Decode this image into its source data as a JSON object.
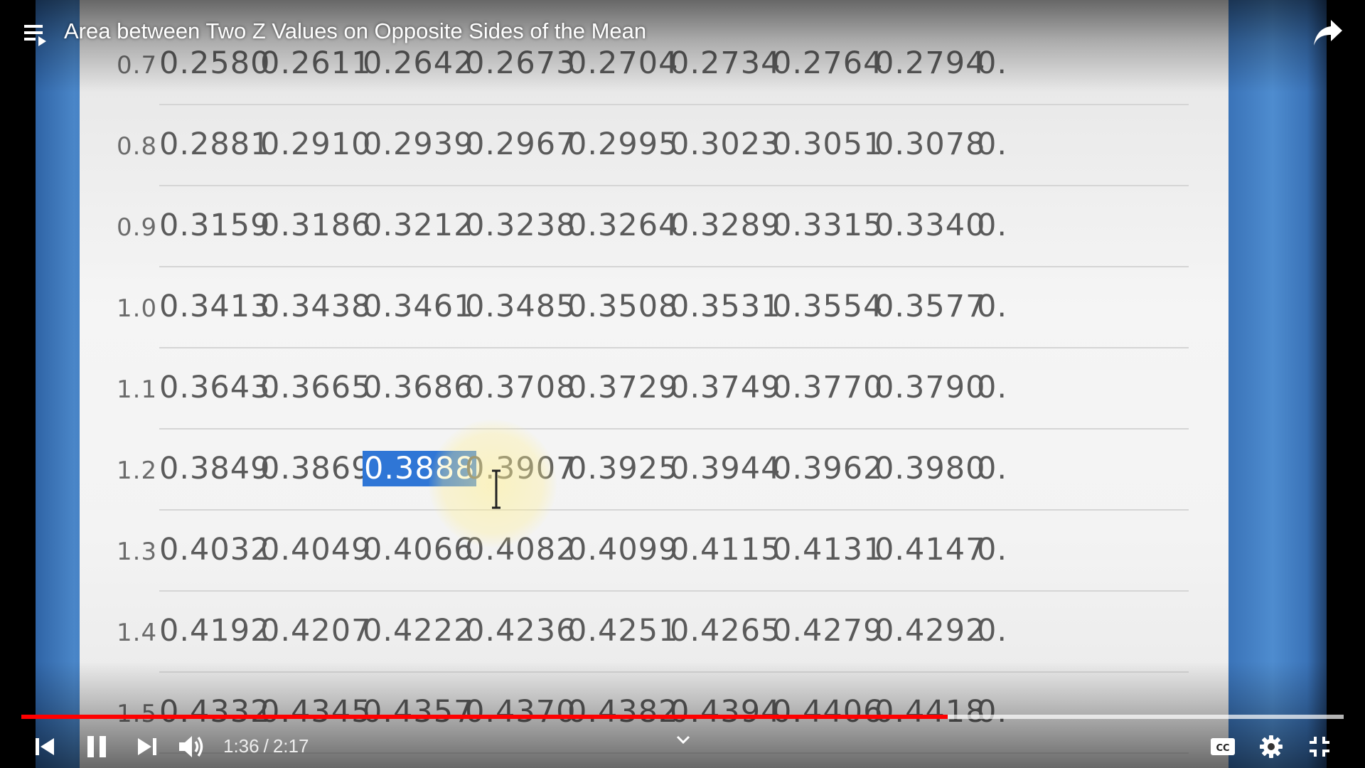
{
  "title_bar": {
    "title": "Area between Two Z Values on Opposite Sides of the Mean"
  },
  "table": {
    "rows": [
      {
        "z": "0.7",
        "values": [
          "0.2580",
          "0.2611",
          "0.2642",
          "0.2673",
          "0.2704",
          "0.2734",
          "0.2764",
          "0.2794",
          "0."
        ]
      },
      {
        "z": "0.8",
        "values": [
          "0.2881",
          "0.2910",
          "0.2939",
          "0.2967",
          "0.2995",
          "0.3023",
          "0.3051",
          "0.3078",
          "0."
        ]
      },
      {
        "z": "0.9",
        "values": [
          "0.3159",
          "0.3186",
          "0.3212",
          "0.3238",
          "0.3264",
          "0.3289",
          "0.3315",
          "0.3340",
          "0."
        ]
      },
      {
        "z": "1.0",
        "values": [
          "0.3413",
          "0.3438",
          "0.3461",
          "0.3485",
          "0.3508",
          "0.3531",
          "0.3554",
          "0.3577",
          "0."
        ]
      },
      {
        "z": "1.1",
        "values": [
          "0.3643",
          "0.3665",
          "0.3686",
          "0.3708",
          "0.3729",
          "0.3749",
          "0.3770",
          "0.3790",
          "0."
        ]
      },
      {
        "z": "1.2",
        "values": [
          "0.3849",
          "0.3869",
          "0.3888",
          "0.3907",
          "0.3925",
          "0.3944",
          "0.3962",
          "0.3980",
          "0."
        ]
      },
      {
        "z": "1.3",
        "values": [
          "0.4032",
          "0.4049",
          "0.4066",
          "0.4082",
          "0.4099",
          "0.4115",
          "0.4131",
          "0.4147",
          "0."
        ]
      },
      {
        "z": "1.4",
        "values": [
          "0.4192",
          "0.4207",
          "0.4222",
          "0.4236",
          "0.4251",
          "0.4265",
          "0.4279",
          "0.4292",
          "0."
        ]
      },
      {
        "z": "1.5",
        "values": [
          "0.4332",
          "0.4345",
          "0.4357",
          "0.4370",
          "0.4382",
          "0.4394",
          "0.4406",
          "0.4418",
          "0."
        ]
      }
    ],
    "selected_cell": {
      "row": 5,
      "col": 2,
      "value": "0.3888"
    }
  },
  "player": {
    "current_time": "1:36",
    "duration": "2:17",
    "time_separator": "/",
    "progress_fraction": 0.7007,
    "buffered_fraction": 1.0,
    "colors": {
      "played": "#ff0000",
      "selection": "#2f76d6"
    },
    "icons": {
      "playlist": "playlist-icon",
      "share": "share-icon",
      "previous": "skip-previous-icon",
      "pause": "pause-icon",
      "next": "skip-next-icon",
      "volume": "volume-icon",
      "captions": "closed-captions-icon",
      "settings": "gear-icon",
      "exit_fullscreen": "exit-fullscreen-icon",
      "expand": "chevron-down-icon"
    }
  }
}
